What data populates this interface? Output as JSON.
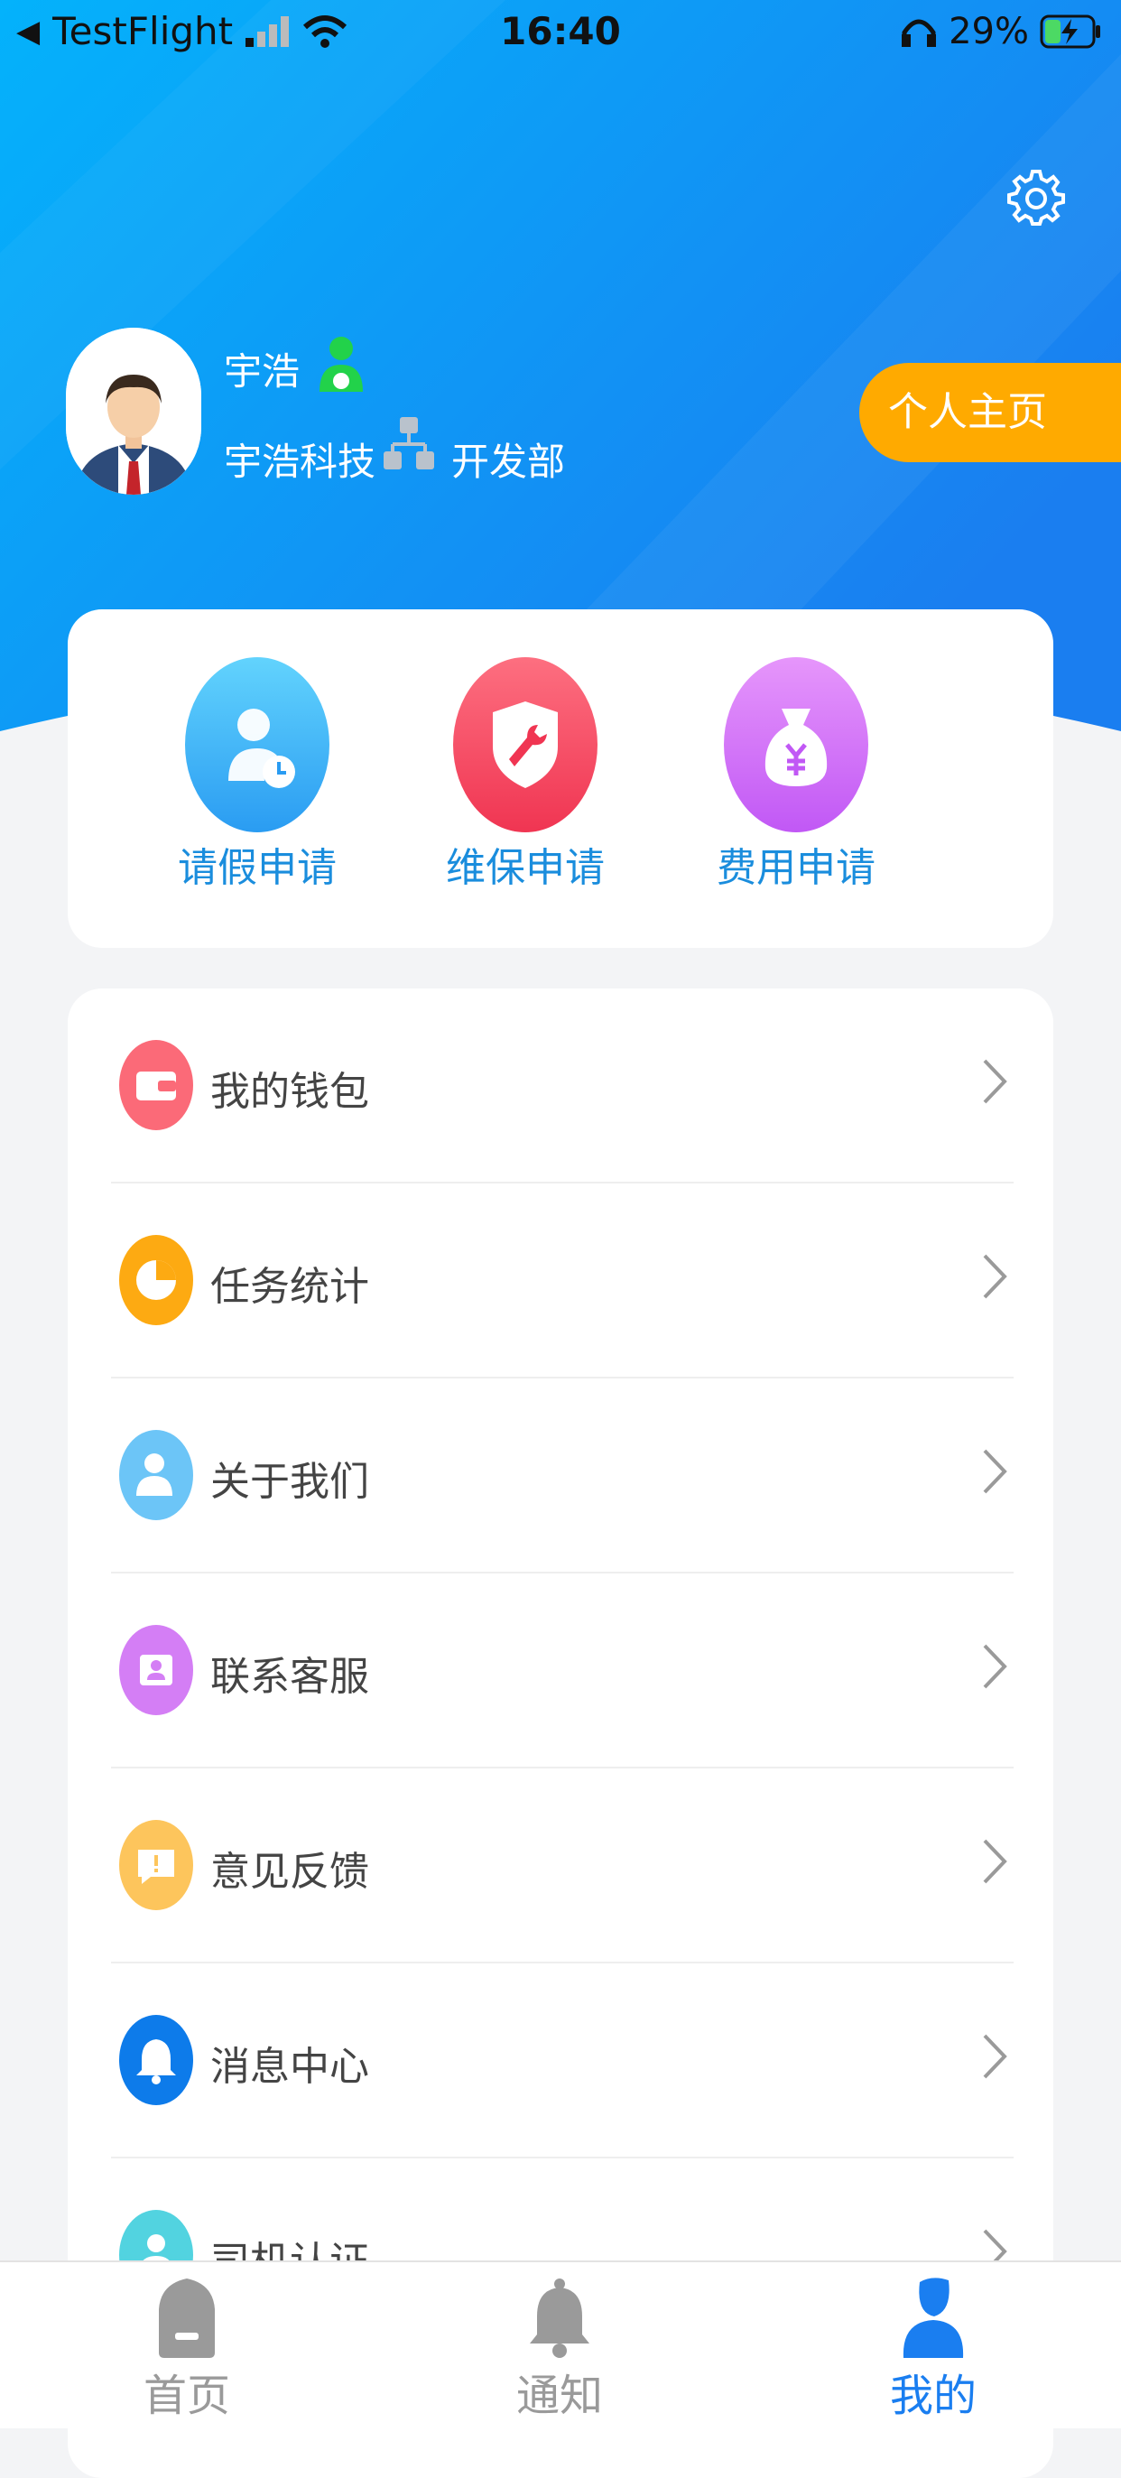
{
  "status_bar": {
    "back_arrow": "◀",
    "app": "TestFlight",
    "time": "16:40",
    "battery": "29%"
  },
  "colors": {
    "header_gradient_start": "#04b2fb",
    "header_gradient_end": "#1a7ef0",
    "accent_orange": "#ffaa00",
    "label_blue": "#1a8ddd",
    "tab_active": "#1a7ef0",
    "tab_inactive": "#9a9a9a"
  },
  "settings": {
    "icon": "gear-icon"
  },
  "profile": {
    "name": "宇浩",
    "company": "宇浩科技",
    "department": "开发部",
    "homepage_button": "个人主页"
  },
  "quick_actions": [
    {
      "label": "请假申请",
      "icon": "leave-clock-icon",
      "color": "#3bb1f6"
    },
    {
      "label": "维保申请",
      "icon": "wrench-shield-icon",
      "color": "#fb4c62"
    },
    {
      "label": "费用申请",
      "icon": "money-bag-icon",
      "color": "#cf6cf6"
    }
  ],
  "menu": [
    {
      "label": "我的钱包",
      "icon": "wallet-icon",
      "color": "#fb6a78"
    },
    {
      "label": "任务统计",
      "icon": "pie-chart-icon",
      "color": "#fdaa12"
    },
    {
      "label": "关于我们",
      "icon": "people-icon",
      "color": "#6cc5f7"
    },
    {
      "label": "联系客服",
      "icon": "contact-card-icon",
      "color": "#d47ef5"
    },
    {
      "label": "意见反馈",
      "icon": "feedback-icon",
      "color": "#fdc55c"
    },
    {
      "label": "消息中心",
      "icon": "bell-icon",
      "color": "#0d7bea"
    },
    {
      "label": "司机认证",
      "icon": "driver-icon",
      "color": "#52d3e0"
    }
  ],
  "tab_bar": [
    {
      "label": "首页",
      "icon": "home-icon",
      "active": false
    },
    {
      "label": "通知",
      "icon": "bell-icon",
      "active": false
    },
    {
      "label": "我的",
      "icon": "person-icon",
      "active": true
    }
  ]
}
